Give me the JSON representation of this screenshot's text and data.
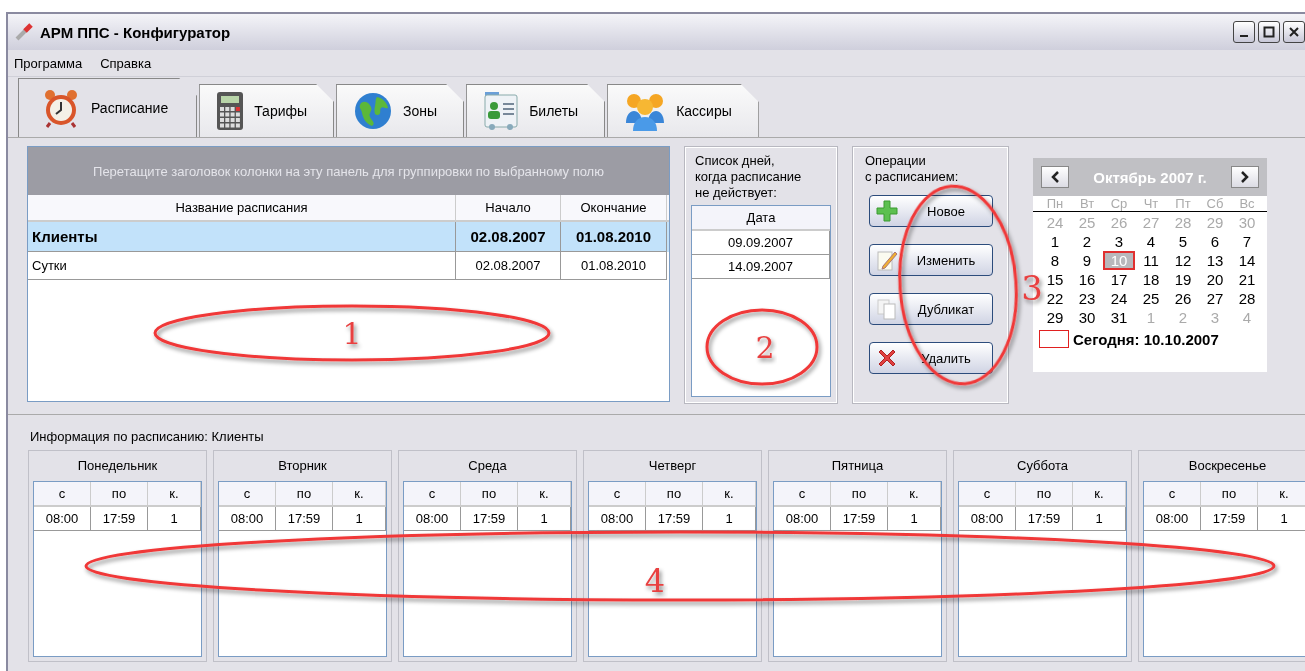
{
  "window": {
    "title": "АРМ ППС - Конфигуратор"
  },
  "menu": [
    "Программа",
    "Справка"
  ],
  "tabs": [
    {
      "label": "Расписание",
      "selected": true
    },
    {
      "label": "Тарифы",
      "selected": false
    },
    {
      "label": "Зоны",
      "selected": false
    },
    {
      "label": "Билеты",
      "selected": false
    },
    {
      "label": "Кассиры",
      "selected": false
    }
  ],
  "schedules": {
    "group_hint": "Перетащите заголовок колонки на эту панель для группировки по выбранному полю",
    "columns": [
      "Название расписания",
      "Начало",
      "Окончание"
    ],
    "rows": [
      {
        "cells": [
          "Клиенты",
          "02.08.2007",
          "01.08.2010"
        ],
        "selected": true
      },
      {
        "cells": [
          "Сутки",
          "02.08.2007",
          "01.08.2010"
        ],
        "selected": false
      }
    ]
  },
  "exceptions": {
    "caption": "Список дней,\nкогда расписание\nне действует:",
    "column": "Дата",
    "dates": [
      "09.09.2007",
      "14.09.2007"
    ]
  },
  "operations": {
    "caption": "Операции\nс расписанием:",
    "buttons": [
      "Новое",
      "Изменить",
      "Дубликат",
      "Удалить"
    ]
  },
  "calendar": {
    "month": "Октябрь 2007 г.",
    "weekdays": [
      "Пн",
      "Вт",
      "Ср",
      "Чт",
      "Пт",
      "Сб",
      "Вс"
    ],
    "days": [
      {
        "day": "24",
        "other_month": true,
        "selected": false
      },
      {
        "day": "25",
        "other_month": true,
        "selected": false
      },
      {
        "day": "26",
        "other_month": true,
        "selected": false
      },
      {
        "day": "27",
        "other_month": true,
        "selected": false
      },
      {
        "day": "28",
        "other_month": true,
        "selected": false
      },
      {
        "day": "29",
        "other_month": true,
        "selected": false
      },
      {
        "day": "30",
        "other_month": true,
        "selected": false
      },
      {
        "day": "1",
        "other_month": false,
        "selected": false
      },
      {
        "day": "2",
        "other_month": false,
        "selected": false
      },
      {
        "day": "3",
        "other_month": false,
        "selected": false
      },
      {
        "day": "4",
        "other_month": false,
        "selected": false
      },
      {
        "day": "5",
        "other_month": false,
        "selected": false
      },
      {
        "day": "6",
        "other_month": false,
        "selected": false
      },
      {
        "day": "7",
        "other_month": false,
        "selected": false
      },
      {
        "day": "8",
        "other_month": false,
        "selected": false
      },
      {
        "day": "9",
        "other_month": false,
        "selected": false
      },
      {
        "day": "10",
        "other_month": false,
        "selected": true
      },
      {
        "day": "11",
        "other_month": false,
        "selected": false
      },
      {
        "day": "12",
        "other_month": false,
        "selected": false
      },
      {
        "day": "13",
        "other_month": false,
        "selected": false
      },
      {
        "day": "14",
        "other_month": false,
        "selected": false
      },
      {
        "day": "15",
        "other_month": false,
        "selected": false
      },
      {
        "day": "16",
        "other_month": false,
        "selected": false
      },
      {
        "day": "17",
        "other_month": false,
        "selected": false
      },
      {
        "day": "18",
        "other_month": false,
        "selected": false
      },
      {
        "day": "19",
        "other_month": false,
        "selected": false
      },
      {
        "day": "20",
        "other_month": false,
        "selected": false
      },
      {
        "day": "21",
        "other_month": false,
        "selected": false
      },
      {
        "day": "22",
        "other_month": false,
        "selected": false
      },
      {
        "day": "23",
        "other_month": false,
        "selected": false
      },
      {
        "day": "24",
        "other_month": false,
        "selected": false
      },
      {
        "day": "25",
        "other_month": false,
        "selected": false
      },
      {
        "day": "26",
        "other_month": false,
        "selected": false
      },
      {
        "day": "27",
        "other_month": false,
        "selected": false
      },
      {
        "day": "28",
        "other_month": false,
        "selected": false
      },
      {
        "day": "29",
        "other_month": false,
        "selected": false
      },
      {
        "day": "30",
        "other_month": false,
        "selected": false
      },
      {
        "day": "31",
        "other_month": false,
        "selected": false
      },
      {
        "day": "1",
        "other_month": true,
        "selected": false
      },
      {
        "day": "2",
        "other_month": true,
        "selected": false
      },
      {
        "day": "3",
        "other_month": true,
        "selected": false
      },
      {
        "day": "4",
        "other_month": true,
        "selected": false
      }
    ],
    "today_label": "Сегодня: 10.10.2007"
  },
  "info": {
    "title": "Информация по расписанию: Клиенты",
    "days": [
      {
        "name": "Понедельник",
        "columns": [
          "с",
          "по",
          "к."
        ],
        "rows": [
          [
            "08:00",
            "17:59",
            "1"
          ]
        ]
      },
      {
        "name": "Вторник",
        "columns": [
          "с",
          "по",
          "к."
        ],
        "rows": [
          [
            "08:00",
            "17:59",
            "1"
          ]
        ]
      },
      {
        "name": "Среда",
        "columns": [
          "с",
          "по",
          "к."
        ],
        "rows": [
          [
            "08:00",
            "17:59",
            "1"
          ]
        ]
      },
      {
        "name": "Четверг",
        "columns": [
          "с",
          "по",
          "к."
        ],
        "rows": [
          [
            "08:00",
            "17:59",
            "1"
          ]
        ]
      },
      {
        "name": "Пятница",
        "columns": [
          "с",
          "по",
          "к."
        ],
        "rows": [
          [
            "08:00",
            "17:59",
            "1"
          ]
        ]
      },
      {
        "name": "Суббота",
        "columns": [
          "с",
          "по",
          "к."
        ],
        "rows": [
          [
            "08:00",
            "17:59",
            "1"
          ]
        ]
      },
      {
        "name": "Воскресенье",
        "columns": [
          "с",
          "по",
          "к."
        ],
        "rows": [
          [
            "08:00",
            "17:59",
            "1"
          ]
        ]
      }
    ]
  },
  "annotations": [
    {
      "label": "1"
    },
    {
      "label": "2"
    },
    {
      "label": "3"
    },
    {
      "label": "4"
    }
  ]
}
